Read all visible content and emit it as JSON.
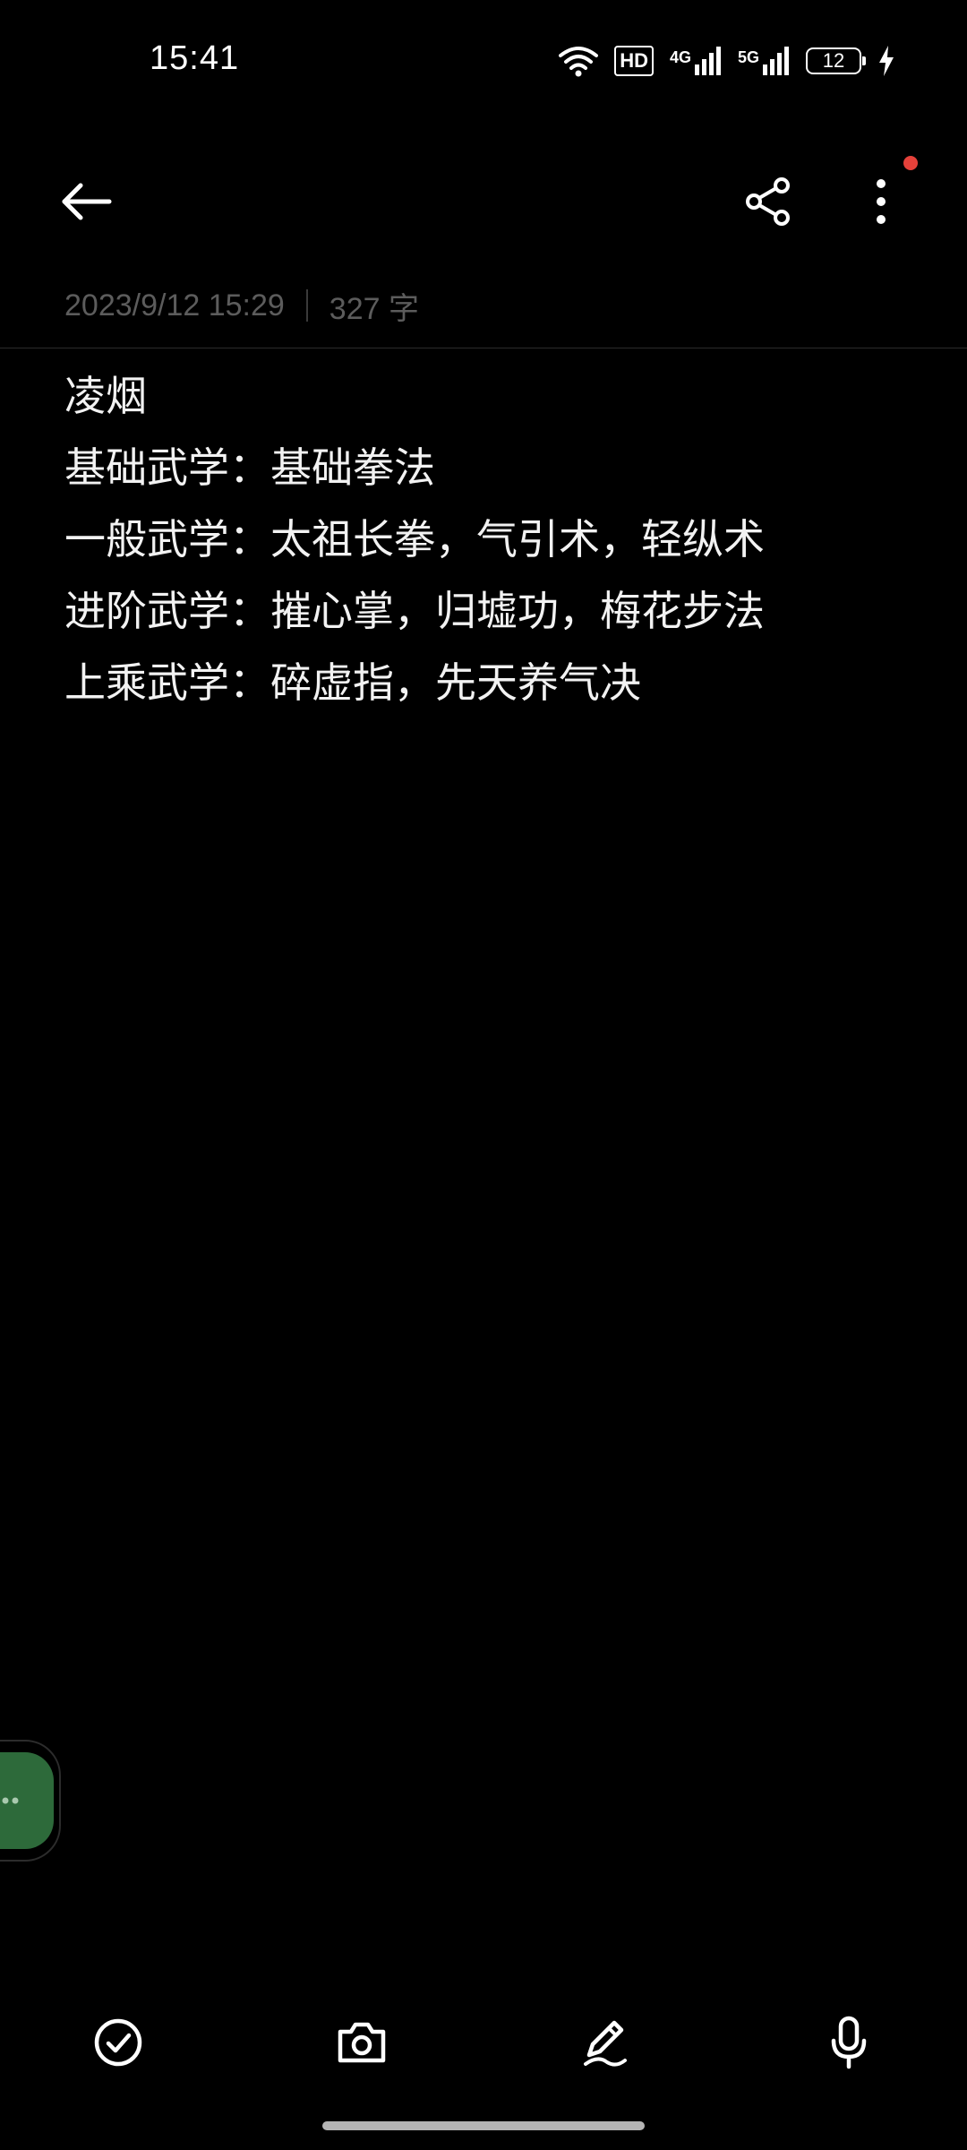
{
  "status_bar": {
    "time": "15:41",
    "hd_label": "HD",
    "network_1": "4G",
    "network_2": "5G",
    "battery_level": "12"
  },
  "toolbar": {
    "back_icon": "back-arrow-icon",
    "share_icon": "share-icon",
    "more_icon": "more-vertical-icon",
    "notification_dot_color": "#e5413a"
  },
  "note": {
    "date": "2023/9/12 15:29",
    "word_count": "327 字",
    "lines": [
      "凌烟",
      "基础武学：基础拳法",
      "一般武学：太祖长拳，气引术，轻纵术",
      "进阶武学：摧心掌，归墟功，梅花步法",
      "上乘武学：碎虚指，先天养气决"
    ]
  },
  "floating_bubble": {
    "color": "#2d6a3a"
  },
  "bottom_bar": {
    "icons": [
      "checklist-icon",
      "camera-icon",
      "pen-icon",
      "microphone-icon"
    ]
  }
}
